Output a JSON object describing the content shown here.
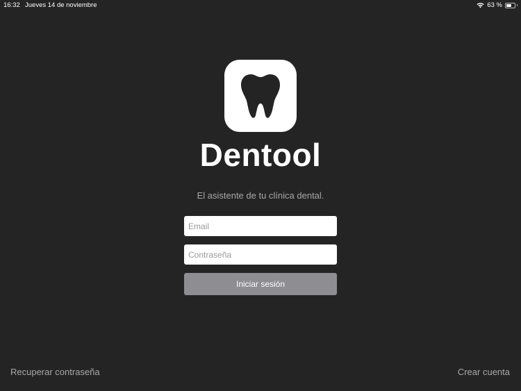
{
  "status_bar": {
    "time": "16:32",
    "date": "Jueves 14 de noviembre",
    "battery_percent_label": "63 %",
    "battery_level": 0.63,
    "wifi_icon": "wifi-icon",
    "battery_icon": "battery-icon"
  },
  "logo": {
    "icon": "tooth-icon",
    "title": "Dentool",
    "tagline": "El asistente de tu clínica dental."
  },
  "form": {
    "email_placeholder": "Email",
    "email_value": "",
    "password_placeholder": "Contraseña",
    "password_value": "",
    "submit_label": "Iniciar sesión"
  },
  "footer": {
    "recover_label": "Recuperar contraseña",
    "create_label": "Crear cuenta"
  },
  "colors": {
    "background": "#242424",
    "button": "#8d8d92",
    "secondary_text": "#a8a8a8",
    "logo_background": "#ffffff"
  }
}
